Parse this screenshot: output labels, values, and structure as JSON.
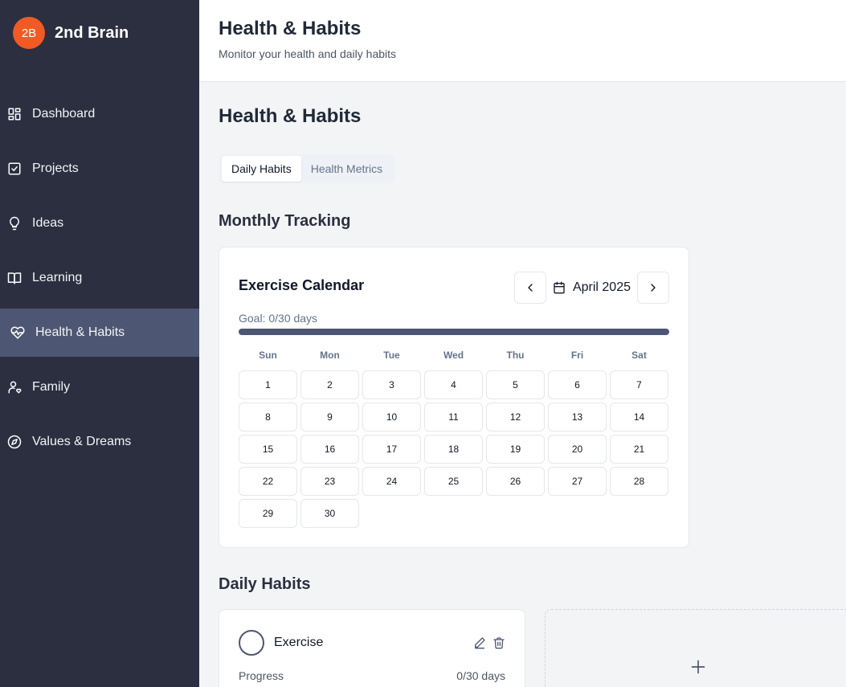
{
  "brand": {
    "logo_text": "2B",
    "name": "2nd Brain",
    "logo_color": "#f15a24"
  },
  "sidebar": {
    "items": [
      {
        "label": "Dashboard",
        "icon": "grid-icon"
      },
      {
        "label": "Projects",
        "icon": "check-square-icon"
      },
      {
        "label": "Ideas",
        "icon": "lightbulb-icon"
      },
      {
        "label": "Learning",
        "icon": "book-open-icon"
      },
      {
        "label": "Health & Habits",
        "icon": "heart-pulse-icon",
        "active": true
      },
      {
        "label": "Family",
        "icon": "user-heart-icon"
      },
      {
        "label": "Values & Dreams",
        "icon": "compass-icon"
      }
    ]
  },
  "header": {
    "title": "Health & Habits",
    "subtitle": "Monitor your health and daily habits"
  },
  "main": {
    "title": "Health & Habits",
    "tabs": [
      {
        "label": "Daily Habits",
        "active": true
      },
      {
        "label": "Health Metrics",
        "active": false
      }
    ],
    "monthly_section_title": "Monthly Tracking",
    "calendar": {
      "title": "Exercise Calendar",
      "month": "April 2025",
      "goal_text": "Goal: 0/30 days",
      "goal_progress": 0,
      "weekdays": [
        "Sun",
        "Mon",
        "Tue",
        "Wed",
        "Thu",
        "Fri",
        "Sat"
      ],
      "days": [
        "1",
        "2",
        "3",
        "4",
        "5",
        "6",
        "7",
        "8",
        "9",
        "10",
        "11",
        "12",
        "13",
        "14",
        "15",
        "16",
        "17",
        "18",
        "19",
        "20",
        "21",
        "22",
        "23",
        "24",
        "25",
        "26",
        "27",
        "28",
        "29",
        "30"
      ]
    },
    "daily_section_title": "Daily Habits",
    "habit": {
      "name": "Exercise",
      "progress_label": "Progress",
      "progress_value": "0/30 days"
    }
  },
  "colors": {
    "sidebar_bg": "#2b2f40",
    "active_nav": "#4d5672",
    "accent": "#f15a24"
  }
}
